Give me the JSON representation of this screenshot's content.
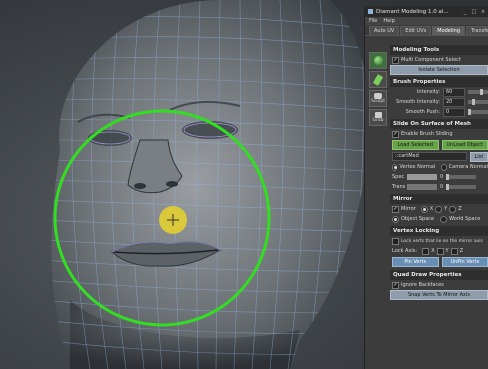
{
  "window": {
    "title": "Diamant Modeling 1.0 al..."
  },
  "menu": [
    "File",
    "Help"
  ],
  "tabs": [
    {
      "label": "Auto UV"
    },
    {
      "label": "Edit UVs"
    },
    {
      "label": "Modeling",
      "active": true
    },
    {
      "label": "Transfer"
    }
  ],
  "tools": [
    {
      "label": "",
      "icon": "sphere-icon"
    },
    {
      "label": "",
      "icon": "brush-icon"
    },
    {
      "label": "Sculpt",
      "icon": "sculpt-icon"
    },
    {
      "label": "Grab",
      "icon": "grab-icon"
    }
  ],
  "modeling_tools": {
    "header": "Modeling Tools",
    "multi_component": {
      "label": "Multi Component Select",
      "checked": true
    },
    "isolate_button": "Isolate Selection"
  },
  "brush": {
    "header": "Brush Properties",
    "intensity": {
      "label": "Intensity:",
      "value": "60"
    },
    "smooth_intensity": {
      "label": "Smooth Intensity:",
      "value": "20"
    },
    "smooth_push": {
      "label": "Smooth Push:",
      "value": "0"
    }
  },
  "slide": {
    "header": "Slide On Surface of Mesh",
    "enable": {
      "label": "Enable Brush Sliding",
      "checked": true
    },
    "load_selected": "Load Selected",
    "unload_object": "UnLoad Object",
    "object_field": "::cartMed",
    "list_button": "List",
    "vertex_normal": "Vertex Normal",
    "camera_normal": "Camera Normal",
    "spec_label": "Spec",
    "spec_value": "0",
    "trans_label": "Trans",
    "trans_value": "0"
  },
  "mirror": {
    "header": "Mirror",
    "mirror_label": "Mirror",
    "axes": [
      "X",
      "Y",
      "Z"
    ],
    "object_space": "Object Space",
    "world_space": "World Space"
  },
  "locking": {
    "header": "Vertex Locking",
    "lock_label": "Lock verts that lie on the mirror axis",
    "lock_axis_label": "Lock Axis:",
    "axes": [
      "X",
      "Y",
      "Z"
    ],
    "pin_button": "Pin Verts",
    "unpin_button": "UnPin Verts"
  },
  "quad": {
    "header": "Quad Draw Properties",
    "ignore_backfaces": {
      "label": "Ignore Backfaces",
      "checked": true
    },
    "snap_button": "Snap Verts To Mirror Axis"
  },
  "colors": {
    "brush_ring": "#33dd22",
    "brush_center": "#e8d22a",
    "mesh_wire": "#8fb8e8"
  }
}
